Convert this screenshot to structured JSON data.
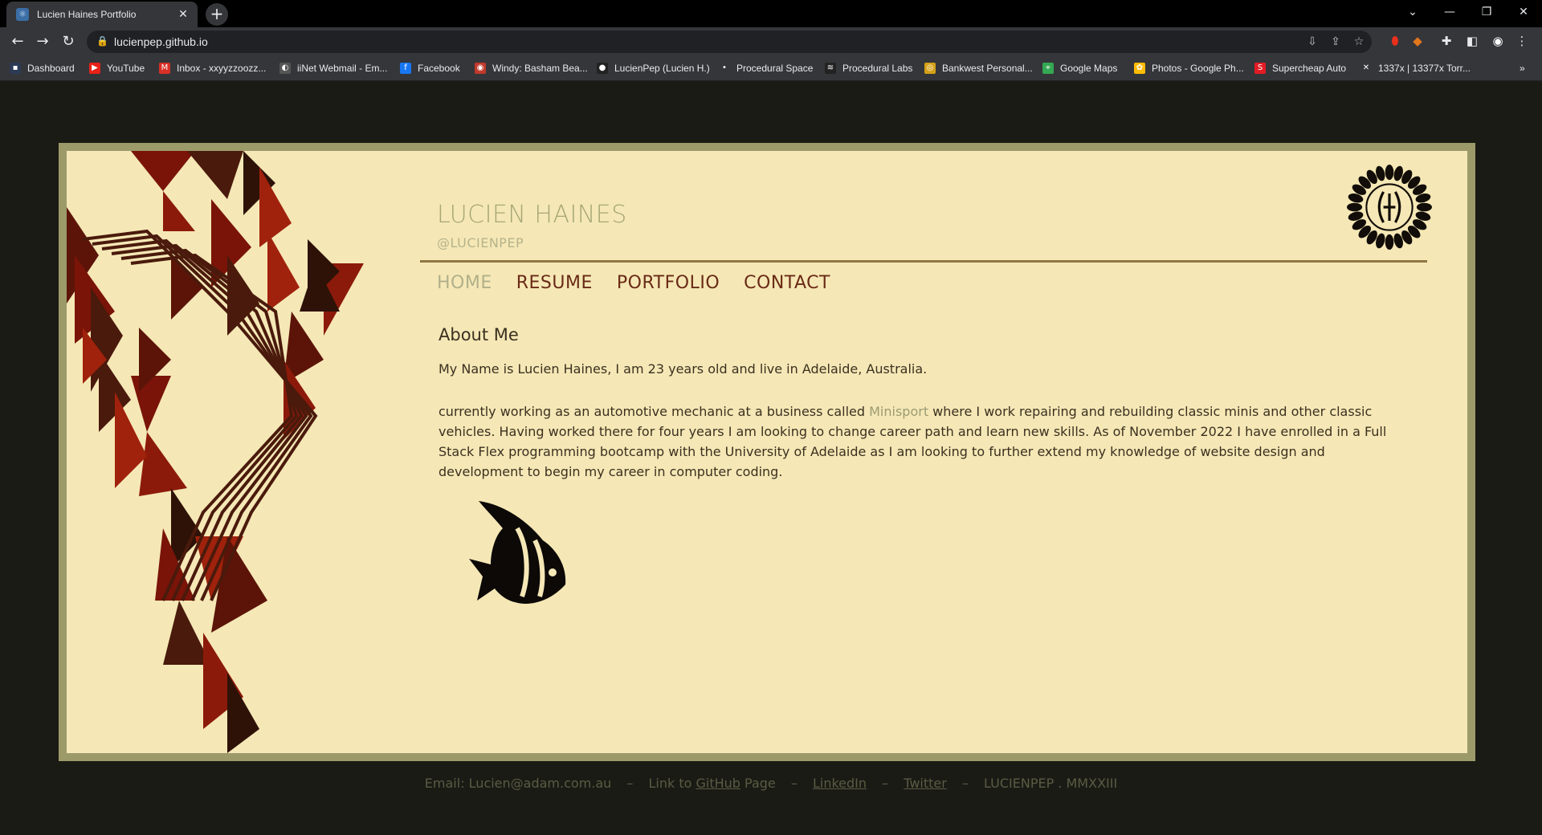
{
  "browser": {
    "tab_title": "Lucien Haines Portfolio",
    "tab_close": "✕",
    "new_tab": "+",
    "url": "lucienpep.github.io",
    "window_controls": [
      "⌄",
      "—",
      "❐",
      "✕"
    ],
    "bookmarks": [
      {
        "label": "Dashboard",
        "icon_color": "#2b3a55",
        "icon": "▪"
      },
      {
        "label": "YouTube",
        "icon_color": "#e62117",
        "icon": "▶"
      },
      {
        "label": "Inbox - xxyyzzoozz...",
        "icon_color": "#d93025",
        "icon": "M"
      },
      {
        "label": "iiNet Webmail - Em...",
        "icon_color": "#555",
        "icon": "◐"
      },
      {
        "label": "Facebook",
        "icon_color": "#1877f2",
        "icon": "f"
      },
      {
        "label": "Windy: Basham Bea...",
        "icon_color": "#c0392b",
        "icon": "◉"
      },
      {
        "label": "LucienPep (Lucien H.)",
        "icon_color": "#222",
        "icon": "●"
      },
      {
        "label": "Procedural Space",
        "icon_color": "#35363a",
        "icon": "•"
      },
      {
        "label": "Procedural Labs",
        "icon_color": "#222",
        "icon": "≋"
      },
      {
        "label": "Bankwest Personal...",
        "icon_color": "#d4a017",
        "icon": "◎"
      },
      {
        "label": "Google Maps",
        "icon_color": "#34a853",
        "icon": "⌖"
      },
      {
        "label": "Photos - Google Ph...",
        "icon_color": "#fbbc05",
        "icon": "✿"
      },
      {
        "label": "Supercheap Auto",
        "icon_color": "#e31b23",
        "icon": "S"
      },
      {
        "label": "1337x | 13377x Torr...",
        "icon_color": "#35363a",
        "icon": "✕"
      }
    ],
    "more_bookmarks": "»"
  },
  "site": {
    "name": "LUCIEN HAINES",
    "handle": "@LUCIENPEP",
    "nav": [
      "HOME",
      "RESUME",
      "PORTFOLIO",
      "CONTACT"
    ],
    "about_title": "About Me",
    "para1": "My Name is Lucien Haines, I am 23 years old and live in Adelaide, Australia.",
    "para2_before": "currently working as an automotive mechanic at a business called ",
    "para2_link": "Minisport",
    "para2_after": " where I work repairing and rebuilding classic minis and other classic vehicles. Having worked there for four years I am looking to change career path and learn new skills. As of November 2022 I have enrolled in a Full Stack Flex programming bootcamp with the University of Adelaide as I am looking to further extend my knowledge of website design and development to begin my career in computer coding."
  },
  "footer": {
    "email": "Email: Lucien@adam.com.au",
    "sep": "–",
    "github_prefix": "Link to ",
    "github_link": "GitHub",
    "github_suffix": " Page",
    "linkedin": "LinkedIn",
    "twitter": "Twitter",
    "copyright": "LUCIENPEP . MMXXIII"
  },
  "colors": {
    "page_bg": "#f5e8b6",
    "frame": "#9d9a6a",
    "accent_dark_red": "#6a2a16",
    "nav_active": "#b2b08a"
  }
}
